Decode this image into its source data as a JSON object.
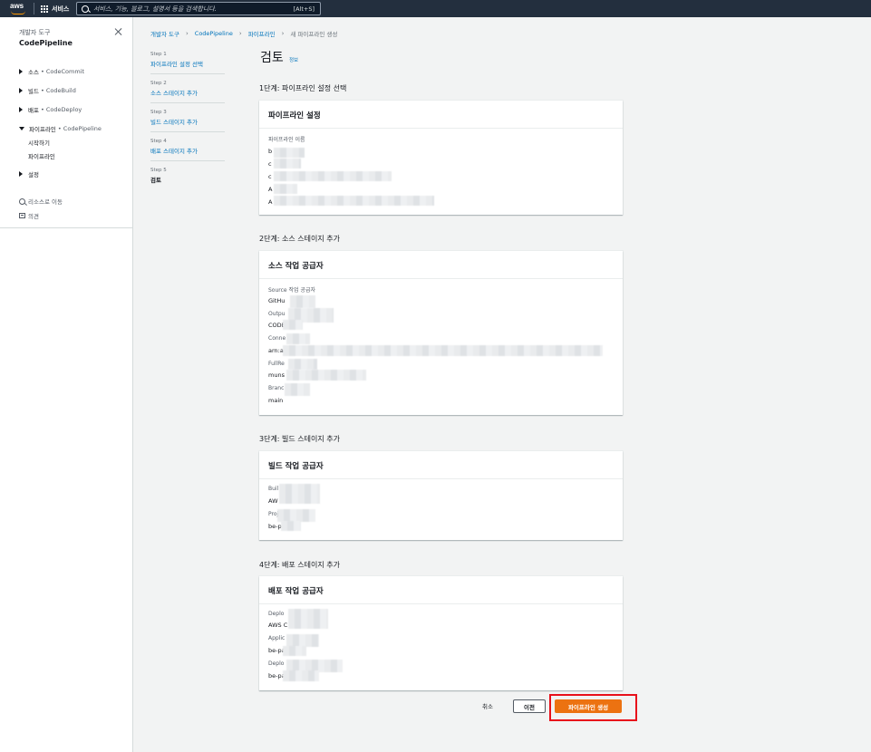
{
  "colors": {
    "nav_bg": "#232f3e",
    "link": "#0073bb",
    "primary": "#ec7211",
    "highlight": "#e8101b"
  },
  "topnav": {
    "logo_icon": "aws-logo",
    "services_label": "서비스",
    "search_placeholder": "서비스, 기능, 블로그, 설명서 등을 검색합니다.",
    "search_shortcut": "[Alt+S]"
  },
  "sidebar": {
    "category": "개발자 도구",
    "title": "CodePipeline",
    "items": [
      {
        "label": "소스",
        "service": "• CodeCommit"
      },
      {
        "label": "빌드",
        "service": "• CodeBuild"
      },
      {
        "label": "배포",
        "service": "• CodeDeploy"
      },
      {
        "label": "파이프라인",
        "service": "• CodePipeline"
      }
    ],
    "sub_items": [
      "시작하기",
      "파이프라인"
    ],
    "settings_label": "설정",
    "goto_resource": "리소스로 이동",
    "feedback": "의견"
  },
  "breadcrumb": [
    "개발자 도구",
    "CodePipeline",
    "파이프라인",
    "새 파이프라인 생성"
  ],
  "steps": [
    {
      "label": "Step 1",
      "name": "파이프라인 설정 선택"
    },
    {
      "label": "Step 2",
      "name": "소스 스테이지 추가"
    },
    {
      "label": "Step 3",
      "name": "빌드 스테이지 추가"
    },
    {
      "label": "Step 4",
      "name": "배포 스테이지 추가"
    },
    {
      "label": "Step 5",
      "name": "검토"
    }
  ],
  "page": {
    "title": "검토",
    "info": "정보"
  },
  "sections": [
    {
      "heading": "1단계: 파이프라인 설정 선택",
      "panel_title": "파이프라인 설정",
      "fields": [
        {
          "label": "파이프라인 이름",
          "value": "b"
        },
        {
          "label": "",
          "value": "c"
        },
        {
          "label": "",
          "value": "c"
        },
        {
          "label": "",
          "value": "A"
        },
        {
          "label": "",
          "value": "A"
        }
      ]
    },
    {
      "heading": "2단계: 소스 스테이지 추가",
      "panel_title": "소스 작업 공급자",
      "fields": [
        {
          "label": "Source 작업 공급자",
          "value": "GitHu"
        },
        {
          "label": "Outpu",
          "value": "CODE"
        },
        {
          "label": "Conne",
          "value": "arn:a"
        },
        {
          "label": "FullRe",
          "value": "muns"
        },
        {
          "label": "Branc",
          "value": "main"
        }
      ]
    },
    {
      "heading": "3단계: 빌드 스테이지 추가",
      "panel_title": "빌드 작업 공급자",
      "fields": [
        {
          "label": "Buil",
          "value": "AW"
        },
        {
          "label": "Proj",
          "value": "be-pan-re"
        }
      ]
    },
    {
      "heading": "4단계: 배포 스테이지 추가",
      "panel_title": "배포 작업 공급자",
      "fields": [
        {
          "label": "Deplo",
          "value": "AWS C"
        },
        {
          "label": "Applic",
          "value": "be-pa"
        },
        {
          "label": "Deplo",
          "value": "be-pa"
        }
      ]
    }
  ],
  "footer": {
    "cancel": "취소",
    "previous": "이전",
    "create": "파이프라인 생성"
  }
}
